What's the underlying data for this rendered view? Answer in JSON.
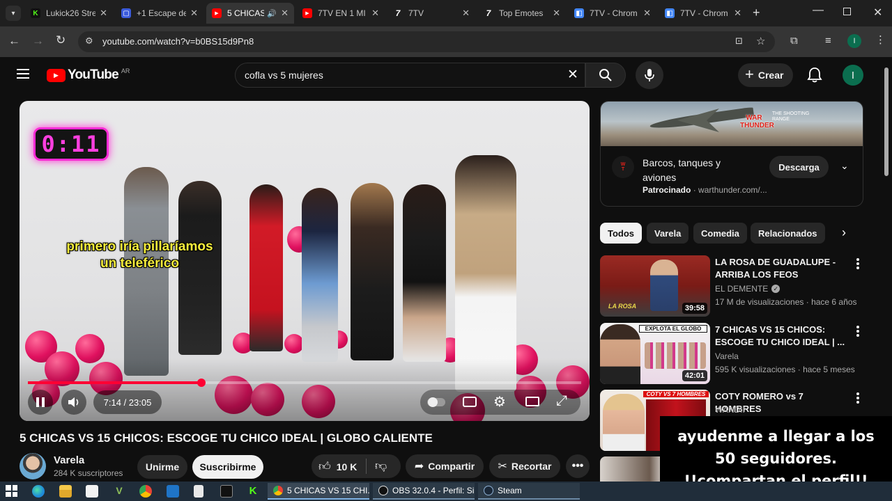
{
  "browser": {
    "tabs": [
      {
        "title": "Lukick26 Stre",
        "color": "#53fc18",
        "glyph": "K"
      },
      {
        "title": "+1 Escape de",
        "color": "#3b5bdb",
        "glyph": "▢"
      },
      {
        "title": "5 CHICAS",
        "color": "#ff0000",
        "glyph": "▶"
      },
      {
        "title": "7TV EN 1 MI",
        "color": "#ff0000",
        "glyph": "▶"
      },
      {
        "title": "7TV",
        "color": "#2a2a2a",
        "glyph": "7"
      },
      {
        "title": "Top Emotes",
        "color": "#2a2a2a",
        "glyph": "7"
      },
      {
        "title": "7TV - Chrom",
        "color": "#4285f4",
        "glyph": "◧"
      },
      {
        "title": "7TV - Chrom",
        "color": "#4285f4",
        "glyph": "◧"
      }
    ],
    "url": "youtube.com/watch?v=b0BS15d9Pn8",
    "profile_initial": "I"
  },
  "youtube": {
    "logo_text": "YouTube",
    "country": "AR",
    "search_query": "cofla vs 5 mujeres",
    "create_label": "Crear",
    "avatar_initial": "I"
  },
  "video": {
    "timer_overlay": "0:11",
    "caption_line1": "primero iría pillaríamos",
    "caption_line2": "un teleférico",
    "time_label": "7:14 / 23:05",
    "progress": 0.313,
    "title": "5 CHICAS VS 15 CHICOS: ESCOGE TU CHICO IDEAL | GLOBO CALIENTE",
    "channel": "Varela",
    "subscribers": "284 K suscriptores",
    "join_label": "Unirme",
    "subscribe_label": "Suscribirme",
    "likes": "10 K",
    "share_label": "Compartir",
    "clip_label": "Recortar"
  },
  "ad": {
    "game_text": "WAR THUNDER",
    "tagline": "THE SHOOTING RANGE",
    "title": "Barcos, tanques y aviones",
    "sponsored": "Patrocinado",
    "domain": "warthunder.com/...",
    "button": "Descarga"
  },
  "chips": [
    "Todos",
    "Varela",
    "Comedia",
    "Relacionados"
  ],
  "recommendations": [
    {
      "title": "LA ROSA DE GUADALUPE - ARRIBA LOS FEOS",
      "channel": "EL DEMENTE",
      "verified": true,
      "meta": "17 M de visualizaciones · hace 6 años",
      "duration": "39:58",
      "thumb_text": "LA ROSA"
    },
    {
      "title": "7 CHICAS VS 15 CHICOS: ESCOGE TU CHICO IDEAL | ...",
      "channel": "Varela",
      "verified": false,
      "meta": "595 K visualizaciones · hace 5 meses",
      "duration": "42:01",
      "thumb_text": "EXPLOTA EL GLOBO"
    },
    {
      "title": "COTY ROMERO vs 7 HOMBRES",
      "channel": "WANDII",
      "verified": false,
      "meta": "",
      "duration": "",
      "thumb_text": "COTY VS 7 HOMBRES"
    }
  ],
  "taskbar": {
    "apps": [
      {
        "label": "5 CHICAS VS 15 CHI...",
        "active": true
      },
      {
        "label": "OBS 32.0.4 - Perfil: Si...",
        "active": false
      },
      {
        "label": "Steam",
        "active": false
      }
    ]
  },
  "overlay": {
    "line1": "ayudenme a llegar a los",
    "line2": "50 seguidores.",
    "line3": "!!compartan el perfil!!"
  }
}
